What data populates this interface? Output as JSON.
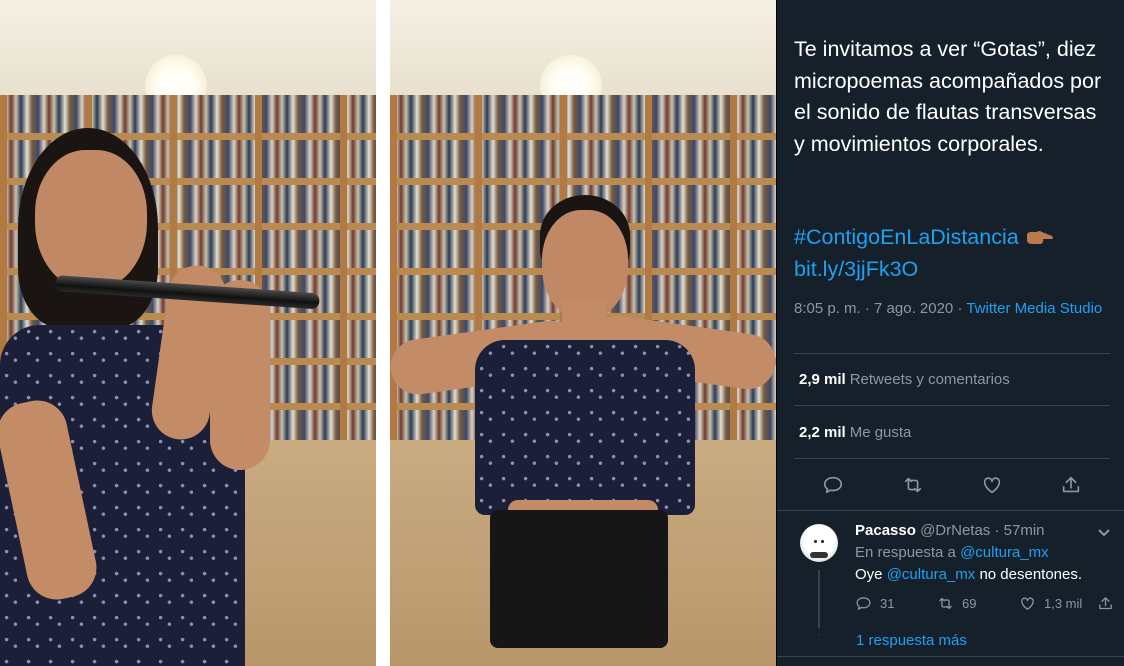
{
  "media": {
    "left_video": "woman-playing-flute",
    "right_video": "woman-dancing"
  },
  "tweet": {
    "text": "Te invitamos a ver “Gotas”, diez micropoemas acompañados por el sonido de flautas transversas y movimientos corporales.",
    "hashtag": "#ContigoEnLaDistancia",
    "hashtag_emoji": "backhand-index-pointing-right",
    "link": "bit.ly/3jjFk3O",
    "timestamp": "8:05 p. m. · 7 ago. 2020",
    "source_separator": " · ",
    "source": "Twitter Media Studio",
    "retweets_count": "2,9 mil",
    "retweets_label": "Retweets y comentarios",
    "likes_count": "2,2 mil",
    "likes_label": "Me gusta",
    "actions": [
      "reply-icon",
      "retweet-icon",
      "like-icon",
      "share-icon"
    ]
  },
  "reply": {
    "display_name": "Pacasso",
    "handle": "@DrNetas",
    "time": "57min",
    "in_reply_prefix": "En respuesta a ",
    "in_reply_handle": "@cultura_mx",
    "text_prefix": "Oye ",
    "text_mention": "@cultura_mx",
    "text_suffix": " no desentones.",
    "reply_count": "31",
    "retweet_count": "69",
    "like_count": "1,3 mil",
    "more_replies": "1 respuesta más"
  },
  "colors": {
    "background": "#15202b",
    "link": "#1da1f2",
    "secondary_text": "#8899a6",
    "divider": "#38444d"
  }
}
